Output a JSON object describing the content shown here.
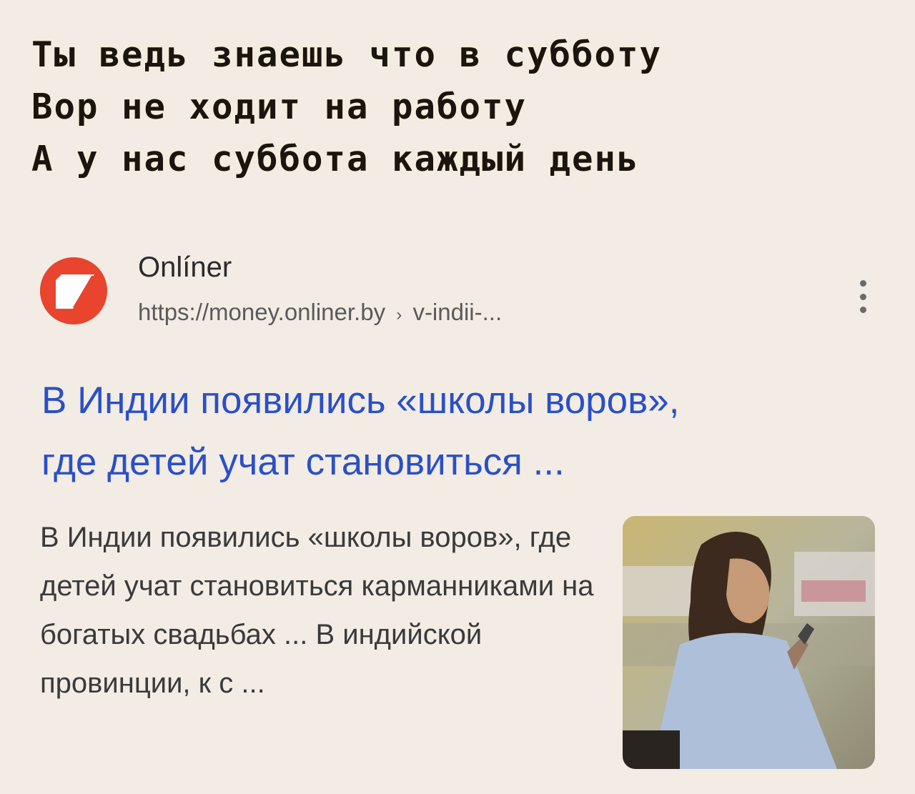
{
  "meme_caption": {
    "line1": "Ты ведь знаешь что в субботу",
    "line2": "Вор не ходит на работу",
    "line3": "А у нас суббота каждый день"
  },
  "result": {
    "site_name": "Onlíner",
    "url_base": "https://money.onliner.by",
    "url_separator": "›",
    "url_path": "v-indii-...",
    "title_line1": "В Индии появились «школы воров»,",
    "title_line2": "где детей учат становиться ...",
    "snippet": "В Индии появились «школы воров», где детей учат становиться карманниками на богатых свадьбах ... В индийской провинции, к с ...",
    "logo_icon": "onliner-logo-icon",
    "more_icon": "more-vertical-icon",
    "thumbnail_icon": "woman-with-phone-photo"
  },
  "colors": {
    "link": "#2a4fc8",
    "logo": "#e8442e",
    "background": "#f2ece4"
  }
}
